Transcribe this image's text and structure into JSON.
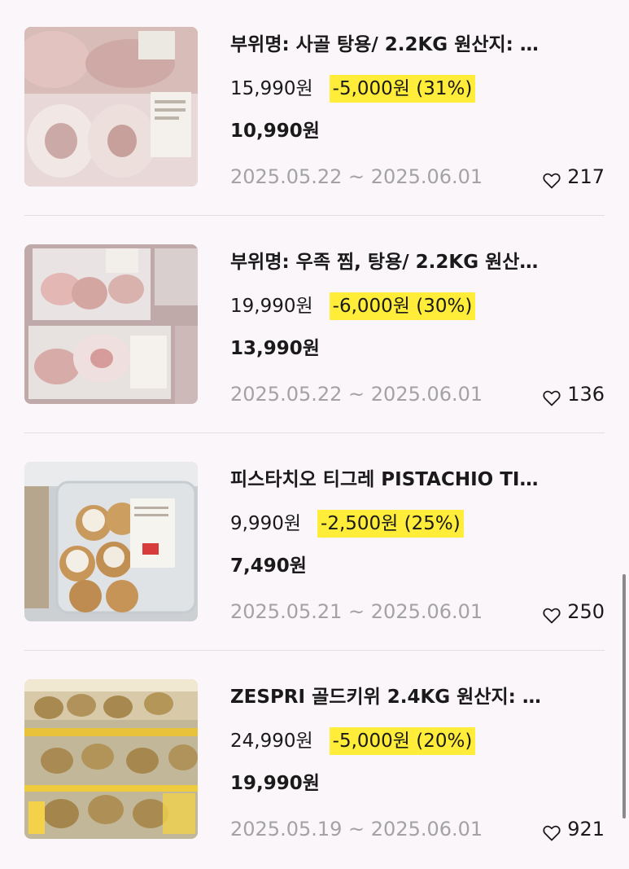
{
  "items": [
    {
      "title": "부위명: 사골 탕용/ 2.2KG 원산지: …",
      "original_price": "15,990원",
      "discount": "-5,000원 (31%)",
      "final_price": "10,990원",
      "dates": "2025.05.22 ~ 2025.06.01",
      "likes": "217"
    },
    {
      "title": "부위명: 우족 찜, 탕용/ 2.2KG 원산…",
      "original_price": "19,990원",
      "discount": "-6,000원 (30%)",
      "final_price": "13,990원",
      "dates": "2025.05.22 ~ 2025.06.01",
      "likes": "136"
    },
    {
      "title": "피스타치오 티그레 PISTACHIO TI…",
      "original_price": "9,990원",
      "discount": "-2,500원 (25%)",
      "final_price": "7,490원",
      "dates": "2025.05.21 ~ 2025.06.01",
      "likes": "250"
    },
    {
      "title": "ZESPRI 골드키위 2.4KG 원산지: …",
      "original_price": "24,990원",
      "discount": "-5,000원 (20%)",
      "final_price": "19,990원",
      "dates": "2025.05.19 ~ 2025.06.01",
      "likes": "921"
    }
  ],
  "icons": {
    "like": "heart-outline-icon"
  },
  "colors": {
    "background": "#fbf6f9",
    "discount_highlight": "#ffed3a",
    "date_text": "#a3a3a3",
    "divider": "#e3dde1"
  }
}
